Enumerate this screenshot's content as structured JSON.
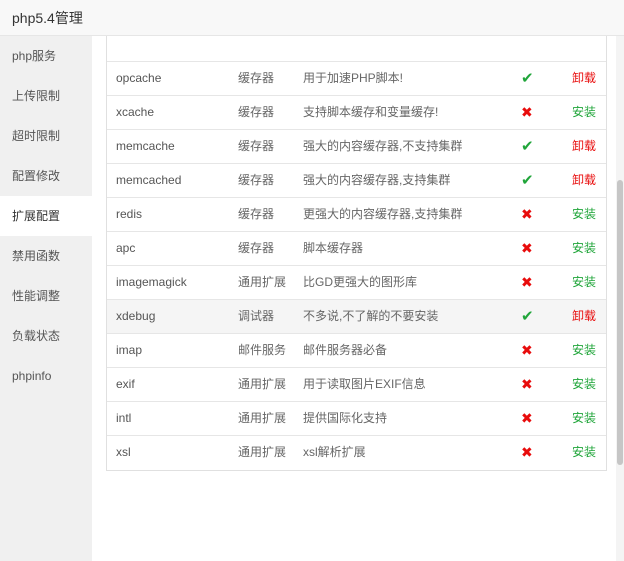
{
  "window": {
    "title": "php5.4管理"
  },
  "sidebar": {
    "items": [
      {
        "label": "php服务"
      },
      {
        "label": "上传限制"
      },
      {
        "label": "超时限制"
      },
      {
        "label": "配置修改"
      },
      {
        "label": "扩展配置",
        "active": true
      },
      {
        "label": "禁用函数"
      },
      {
        "label": "性能调整"
      },
      {
        "label": "负载状态"
      },
      {
        "label": "phpinfo"
      }
    ]
  },
  "extensions": {
    "rows": [
      {
        "name": "opcache",
        "type": "缓存器",
        "desc": "用于加速PHP脚本!",
        "status": "✔",
        "installed": true,
        "action": "卸载"
      },
      {
        "name": "xcache",
        "type": "缓存器",
        "desc": "支持脚本缓存和变量缓存!",
        "status": "✖",
        "installed": false,
        "action": "安装"
      },
      {
        "name": "memcache",
        "type": "缓存器",
        "desc": "强大的内容缓存器,不支持集群",
        "status": "✔",
        "installed": true,
        "action": "卸载"
      },
      {
        "name": "memcached",
        "type": "缓存器",
        "desc": "强大的内容缓存器,支持集群",
        "status": "✔",
        "installed": true,
        "action": "卸载"
      },
      {
        "name": "redis",
        "type": "缓存器",
        "desc": "更强大的内容缓存器,支持集群",
        "status": "✖",
        "installed": false,
        "action": "安装"
      },
      {
        "name": "apc",
        "type": "缓存器",
        "desc": "脚本缓存器",
        "status": "✖",
        "installed": false,
        "action": "安装"
      },
      {
        "name": "imagemagick",
        "type": "通用扩展",
        "desc": "比GD更强大的图形库",
        "status": "✖",
        "installed": false,
        "action": "安装"
      },
      {
        "name": "xdebug",
        "type": "调试器",
        "desc": "不多说,不了解的不要安装",
        "status": "✔",
        "installed": true,
        "action": "卸载"
      },
      {
        "name": "imap",
        "type": "邮件服务",
        "desc": "邮件服务器必备",
        "status": "✖",
        "installed": false,
        "action": "安装"
      },
      {
        "name": "exif",
        "type": "通用扩展",
        "desc": "用于读取图片EXIF信息",
        "status": "✖",
        "installed": false,
        "action": "安装"
      },
      {
        "name": "intl",
        "type": "通用扩展",
        "desc": "提供国际化支持",
        "status": "✖",
        "installed": false,
        "action": "安装"
      },
      {
        "name": "xsl",
        "type": "通用扩展",
        "desc": "xsl解析扩展",
        "status": "✖",
        "installed": false,
        "action": "安装"
      }
    ]
  },
  "colors": {
    "install": "#20a53a",
    "uninstall": "#e80c0c",
    "sidebar_bg": "#f0f0f0",
    "titlebar_bg": "#f8f8f8"
  }
}
